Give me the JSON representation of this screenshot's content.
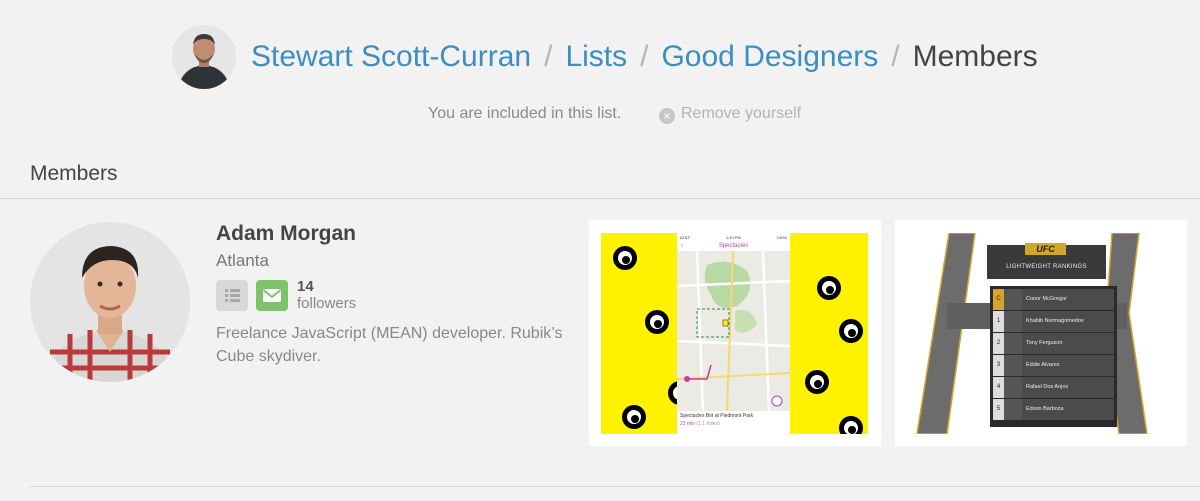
{
  "breadcrumb": {
    "owner": "Stewart Scott-Curran",
    "lists": "Lists",
    "list_name": "Good Designers",
    "current": "Members",
    "separator": "/"
  },
  "status": {
    "included_text": "You are included in this list.",
    "remove_label": "Remove yourself",
    "remove_icon": "close-circle-icon"
  },
  "section": {
    "title": "Members"
  },
  "member": {
    "name": "Adam Morgan",
    "location": "Atlanta",
    "followers_count": "14",
    "followers_label": "followers",
    "bio": "Freelance JavaScript (MEAN) developer. Rubik’s Cube skydiver.",
    "list_icon": "list-icon",
    "mail_icon": "mail-icon"
  },
  "shots": [
    {
      "status_carrier": "AT&T",
      "status_time": "1:20 PM",
      "status_battery": "100%",
      "app_title": "Spectacles",
      "place_title": "Spectacles Bot at Piedmont Park",
      "eta": "22 min",
      "distance": "(1.1 miles)"
    },
    {
      "logo": "UFC",
      "title": "LIGHTWEIGHT RANKINGS",
      "rows": [
        {
          "rank": "C",
          "name": "Conor McGregor"
        },
        {
          "rank": "1",
          "name": "Khabib Nurmagomedov"
        },
        {
          "rank": "2",
          "name": "Tony Ferguson"
        },
        {
          "rank": "3",
          "name": "Eddie Alvarez"
        },
        {
          "rank": "4",
          "name": "Rafael Dos Anjos"
        },
        {
          "rank": "5",
          "name": "Edson Barboza"
        }
      ]
    }
  ],
  "colors": {
    "link": "#3d8ec0",
    "mail_button": "#7cc36c",
    "spectacles_yellow": "#fff200",
    "ufc_gold": "#d4a52a"
  }
}
